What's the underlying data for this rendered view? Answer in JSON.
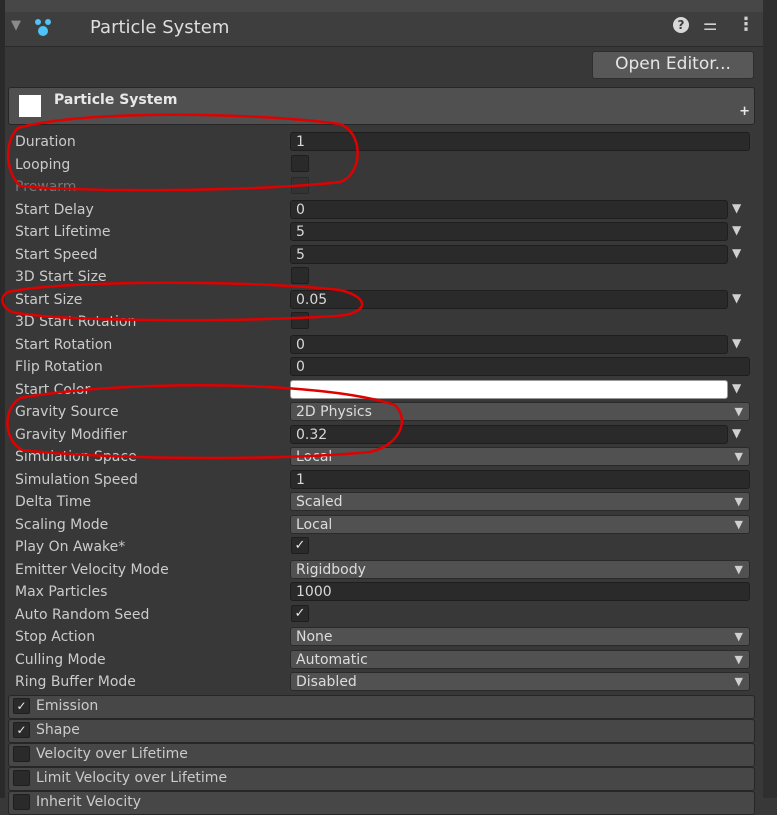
{
  "header": {
    "title": "Particle System",
    "help_glyph": "?",
    "sliders_glyph": "⚌",
    "kebab_glyph": "⋮",
    "fold_glyph": "▼"
  },
  "open_editor_label": "Open Editor...",
  "module_header": {
    "label": "Particle System",
    "plus": "+"
  },
  "rows": [
    {
      "label": "Duration",
      "type": "text",
      "value": "1"
    },
    {
      "label": "Looping",
      "type": "check",
      "checked": false
    },
    {
      "label": "Prewarm",
      "type": "check",
      "checked": false,
      "disabled": true
    },
    {
      "label": "Start Delay",
      "type": "curve",
      "value": "0"
    },
    {
      "label": "Start Lifetime",
      "type": "curve",
      "value": "5"
    },
    {
      "label": "Start Speed",
      "type": "curve",
      "value": "5"
    },
    {
      "label": "3D Start Size",
      "type": "check",
      "checked": false
    },
    {
      "label": "Start Size",
      "type": "curve",
      "value": "0.05"
    },
    {
      "label": "3D Start Rotation",
      "type": "check",
      "checked": false
    },
    {
      "label": "Start Rotation",
      "type": "curve",
      "value": "0"
    },
    {
      "label": "Flip Rotation",
      "type": "text",
      "value": "0"
    },
    {
      "label": "Start Color",
      "type": "color",
      "color": "#ffffff"
    },
    {
      "label": "Gravity Source",
      "type": "dropdown",
      "value": "2D Physics"
    },
    {
      "label": "Gravity Modifier",
      "type": "curve",
      "value": "0.32"
    },
    {
      "label": "Simulation Space",
      "type": "dropdown",
      "value": "Local"
    },
    {
      "label": "Simulation Speed",
      "type": "text",
      "value": "1"
    },
    {
      "label": "Delta Time",
      "type": "dropdown",
      "value": "Scaled"
    },
    {
      "label": "Scaling Mode",
      "type": "dropdown",
      "value": "Local"
    },
    {
      "label": "Play On Awake*",
      "type": "check",
      "checked": true
    },
    {
      "label": "Emitter Velocity Mode",
      "type": "dropdown",
      "value": "Rigidbody"
    },
    {
      "label": "Max Particles",
      "type": "text",
      "value": "1000"
    },
    {
      "label": "Auto Random Seed",
      "type": "check",
      "checked": true
    },
    {
      "label": "Stop Action",
      "type": "dropdown",
      "value": "None"
    },
    {
      "label": "Culling Mode",
      "type": "dropdown",
      "value": "Automatic"
    },
    {
      "label": "Ring Buffer Mode",
      "type": "dropdown",
      "value": "Disabled"
    }
  ],
  "modules": [
    {
      "label": "Emission",
      "checked": true
    },
    {
      "label": "Shape",
      "checked": true
    },
    {
      "label": "Velocity over Lifetime",
      "checked": false
    },
    {
      "label": "Limit Velocity over Lifetime",
      "checked": false
    },
    {
      "label": "Inherit Velocity",
      "checked": false
    }
  ],
  "glyphs": {
    "check": "✓",
    "caret": "▼"
  },
  "colors": {
    "annotation": "#e00000",
    "panel": "#383838",
    "field": "#2a2a2a",
    "dropdown": "#515151"
  }
}
